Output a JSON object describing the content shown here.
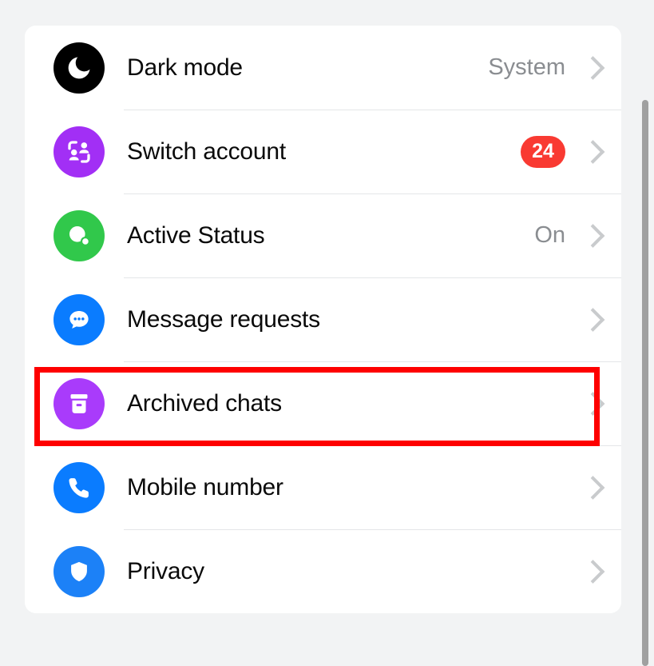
{
  "background_color": "#f2f3f4",
  "card": {
    "background_color": "#ffffff",
    "rows": [
      {
        "label": "Dark mode",
        "value": "System",
        "badge": null,
        "icon": "moon-icon",
        "icon_color": "#000000",
        "chevron": "chevron-right-icon",
        "highlighted": false
      },
      {
        "label": "Switch account",
        "value": null,
        "badge": "24",
        "icon": "switch-account-icon",
        "icon_color": "#a22ff5",
        "chevron": "chevron-right-icon",
        "highlighted": false
      },
      {
        "label": "Active Status",
        "value": "On",
        "badge": null,
        "icon": "active-status-icon",
        "icon_color": "#31c84b",
        "chevron": "chevron-right-icon",
        "highlighted": false
      },
      {
        "label": "Message requests",
        "value": null,
        "badge": null,
        "icon": "message-bubble-icon",
        "icon_color": "#0a7cff",
        "chevron": "chevron-right-icon",
        "highlighted": false
      },
      {
        "label": "Archived chats",
        "value": null,
        "badge": null,
        "icon": "archive-box-icon",
        "icon_color": "#a93bfb",
        "chevron": "chevron-right-icon",
        "highlighted": true
      },
      {
        "label": "Mobile number",
        "value": null,
        "badge": null,
        "icon": "phone-icon",
        "icon_color": "#0a7cff",
        "chevron": "chevron-right-icon",
        "highlighted": false
      },
      {
        "label": "Privacy",
        "value": null,
        "badge": null,
        "icon": "shield-icon",
        "icon_color": "#1c81f7",
        "chevron": "chevron-right-icon",
        "highlighted": false
      }
    ]
  },
  "highlight": {
    "color": "#fe0000",
    "target": "Archived chats"
  },
  "scrollbar": {
    "color": "#a0a0a0"
  },
  "badge_color": "#f93a32",
  "value_text_color": "#8a8d91",
  "chevron_color": "#c9cbcd"
}
